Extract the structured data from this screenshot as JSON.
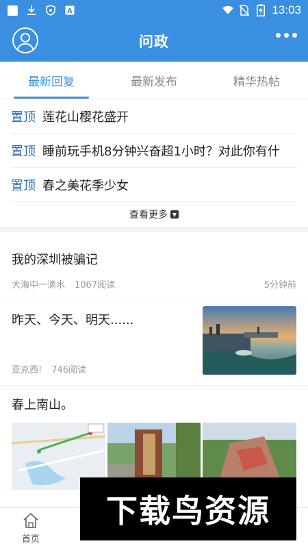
{
  "status_bar": {
    "time": "13:03",
    "icons": [
      "notification-square-icon",
      "download-icon",
      "shield-icon",
      "font-a-icon",
      "wifi-icon",
      "no-sim-icon",
      "battery-charging-icon"
    ]
  },
  "header": {
    "title": "问政",
    "avatar_icon": "user-avatar-icon",
    "more_icon": "more-dots-icon"
  },
  "tabs": [
    {
      "label": "最新回复",
      "active": true
    },
    {
      "label": "最新发布",
      "active": false
    },
    {
      "label": "精华热帖",
      "active": false
    }
  ],
  "pinned": {
    "tag": "置顶",
    "items": [
      {
        "title": "莲花山樱花盛开"
      },
      {
        "title": "睡前玩手机8分钟兴奋超1小时？对此你有什"
      },
      {
        "title": "春之美花季少女"
      }
    ],
    "see_more": "查看更多"
  },
  "posts": [
    {
      "title": "我的深圳被骗记",
      "author": "大海中一滴水",
      "reads": "1067阅读",
      "time": "5分钟前"
    },
    {
      "title": "昨天、今天、明天......",
      "author": "亚克西!",
      "reads": "746阅读"
    },
    {
      "title": "春上南山。"
    }
  ],
  "bottom_nav": [
    {
      "label": "首页",
      "icon": "home-icon"
    }
  ],
  "watermark": {
    "text": "下载鸟资源"
  },
  "colors": {
    "brand": "#3b8fe0",
    "pin_tag": "#2d6eb5"
  }
}
